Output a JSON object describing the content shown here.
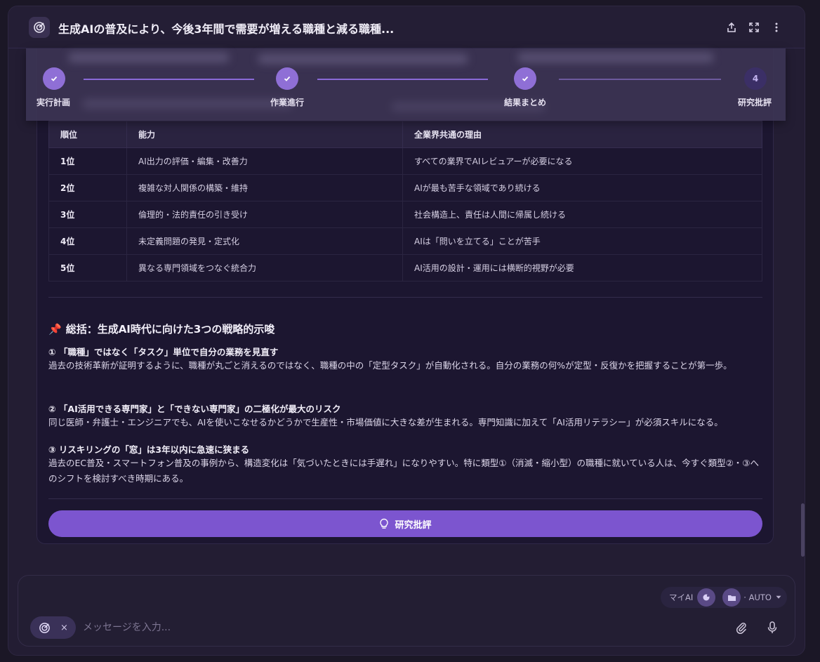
{
  "header": {
    "title": "生成AIの普及により、今後3年間で需要が増える職種と減る職種..."
  },
  "stepper": {
    "steps": [
      {
        "label": "実行計画",
        "done": true
      },
      {
        "label": "作業進行",
        "done": true
      },
      {
        "label": "結果まとめ",
        "done": true
      },
      {
        "label": "研究批評",
        "number": "4",
        "done": false
      }
    ]
  },
  "table": {
    "headers": [
      "順位",
      "能力",
      "全業界共通の理由"
    ],
    "rows": [
      [
        "1位",
        "AI出力の評価・編集・改善力",
        "すべての業界でAIレビュアーが必要になる"
      ],
      [
        "2位",
        "複雑な対人関係の構築・維持",
        "AIが最も苦手な領域であり続ける"
      ],
      [
        "3位",
        "倫理的・法的責任の引き受け",
        "社会構造上、責任は人間に帰属し続ける"
      ],
      [
        "4位",
        "未定義問題の発見・定式化",
        "AIは「問いを立てる」ことが苦手"
      ],
      [
        "5位",
        "異なる専門領域をつなぐ統合力",
        "AI活用の設計・運用には横断的視野が必要"
      ]
    ]
  },
  "summary": {
    "title": "総括：生成AI時代に向けた3つの戦略的示唆",
    "points": [
      {
        "title": "① 「職種」ではなく「タスク」単位で自分の業務を見直す",
        "body": "過去の技術革新が証明するように、職種が丸ごと消えるのではなく、職種の中の「定型タスク」が自動化される。自分の業務の何%が定型・反復かを把握することが第一歩。"
      },
      {
        "title": "② 「AI活用できる専門家」と「できない専門家」の二極化が最大のリスク",
        "body": "同じ医師・弁護士・エンジニアでも、AIを使いこなせるかどうかで生産性・市場価値に大きな差が生まれる。専門知識に加えて「AI活用リテラシー」が必須スキルになる。"
      },
      {
        "title": "③ リスキリングの「窓」は3年以内に急速に狭まる",
        "body": "過去のEC普及・スマートフォン普及の事例から、構造変化は「気づいたときには手遅れ」になりやすい。特に類型①（消滅・縮小型）の職種に就いている人は、今すぐ類型②・③へのシフトを検討すべき時期にある。"
      }
    ]
  },
  "critique_button": {
    "label": "研究批評"
  },
  "composer": {
    "model_label": "マイAI",
    "mode_label": "· AUTO",
    "placeholder": "メッセージを入力...",
    "chip_close": "×"
  },
  "colors": {
    "accent": "#7c55cf",
    "step_done": "#8f6fd6",
    "background": "#1c1630"
  },
  "icons": {
    "app": "research-target-icon",
    "share": "share-icon",
    "expand": "expand-icon",
    "more": "more-vertical-icon",
    "bulb": "lightbulb-icon",
    "attach": "paperclip-icon",
    "mic": "microphone-icon"
  }
}
